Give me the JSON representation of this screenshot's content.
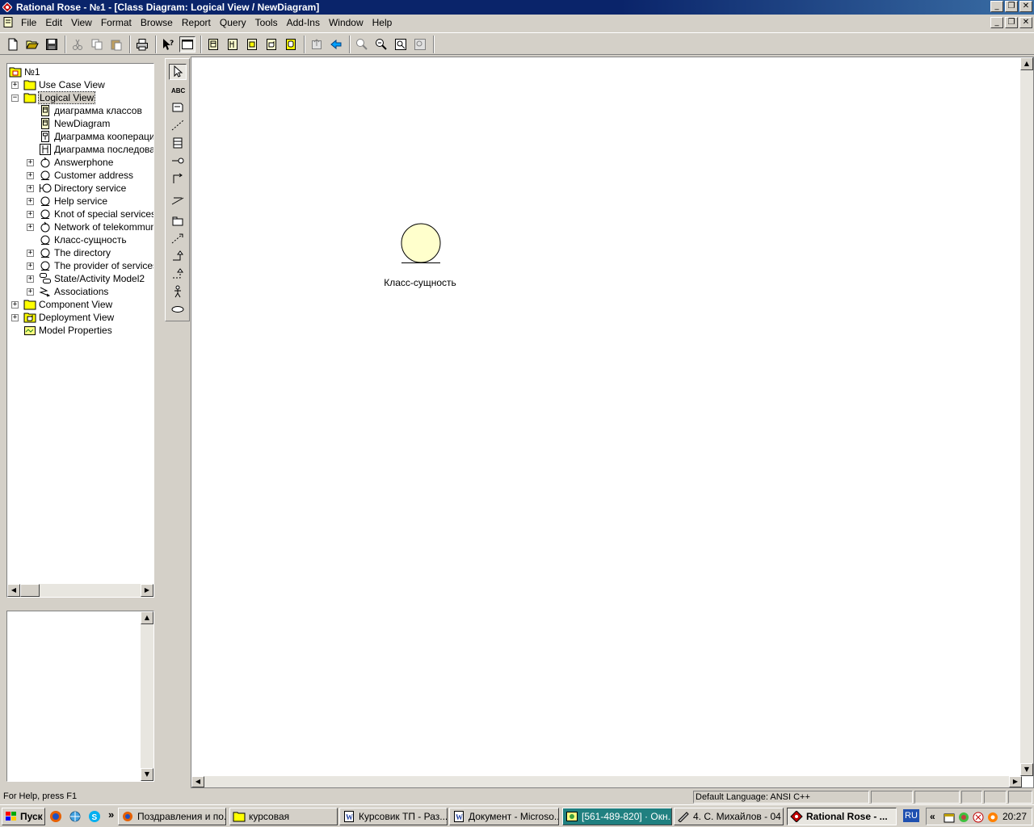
{
  "window": {
    "title": "Rational Rose - №1 - [Class Diagram: Logical View / NewDiagram]"
  },
  "menu": [
    "File",
    "Edit",
    "View",
    "Format",
    "Browse",
    "Report",
    "Query",
    "Tools",
    "Add-Ins",
    "Window",
    "Help"
  ],
  "toolbar_icons": [
    "new-icon",
    "open-icon",
    "save-icon",
    "cut-icon",
    "copy-icon",
    "paste-icon",
    "print-icon",
    "context-help-icon",
    "view-documentation-icon",
    "browse-class-diagram-icon",
    "browse-interaction-diagram-icon",
    "browse-component-diagram-icon",
    "browse-deployment-diagram-icon",
    "browse-parent-icon",
    "browse-previous-icon",
    "zoom-in-icon",
    "zoom-out-icon",
    "fit-in-window-icon",
    "undo-fit-icon"
  ],
  "tree": {
    "root": "№1",
    "items": [
      {
        "label": "Use Case View",
        "level": 0,
        "icon": "folder-icon",
        "expander": "+"
      },
      {
        "label": "Logical View",
        "level": 0,
        "icon": "folder-open-icon",
        "expander": "-",
        "selected": true
      },
      {
        "label": "диаграмма классов",
        "level": 1,
        "icon": "class-diagram-icon",
        "expander": ""
      },
      {
        "label": "NewDiagram",
        "level": 1,
        "icon": "class-diagram-icon",
        "expander": ""
      },
      {
        "label": "Диаграмма коопераци",
        "level": 1,
        "icon": "collaboration-diagram-icon",
        "expander": ""
      },
      {
        "label": "Диаграмма последоват",
        "level": 1,
        "icon": "sequence-diagram-icon",
        "expander": ""
      },
      {
        "label": "Answerphone",
        "level": 1,
        "icon": "control-class-icon",
        "expander": "+"
      },
      {
        "label": "Customer address",
        "level": 1,
        "icon": "entity-class-icon",
        "expander": "+"
      },
      {
        "label": "Directory service",
        "level": 1,
        "icon": "boundary-class-icon",
        "expander": "+"
      },
      {
        "label": "Help service",
        "level": 1,
        "icon": "entity-class-icon",
        "expander": "+"
      },
      {
        "label": "Knot of special services",
        "level": 1,
        "icon": "entity-class-icon",
        "expander": "+"
      },
      {
        "label": "Network of telekommunic",
        "level": 1,
        "icon": "control-class-icon",
        "expander": "+"
      },
      {
        "label": "Класс-сущность",
        "level": 1,
        "icon": "entity-class-icon",
        "expander": ""
      },
      {
        "label": "The directory",
        "level": 1,
        "icon": "entity-class-icon",
        "expander": "+"
      },
      {
        "label": "The provider of services c",
        "level": 1,
        "icon": "entity-class-icon",
        "expander": "+"
      },
      {
        "label": "State/Activity Model2",
        "level": 1,
        "icon": "state-activity-model-icon",
        "expander": "+"
      },
      {
        "label": "Associations",
        "level": 1,
        "icon": "associations-icon",
        "expander": "+"
      },
      {
        "label": "Component View",
        "level": 0,
        "icon": "folder-icon",
        "expander": "+"
      },
      {
        "label": "Deployment View",
        "level": 0,
        "icon": "deployment-view-icon",
        "expander": "+"
      },
      {
        "label": "Model Properties",
        "level": 0,
        "icon": "model-properties-icon",
        "expander": ""
      }
    ]
  },
  "diagram_tools": [
    "selection-tool-icon",
    "text-box-tool-icon",
    "note-tool-icon",
    "anchor-note-tool-icon",
    "class-tool-icon",
    "interface-tool-icon",
    "unidirectional-association-tool-icon",
    "association-class-tool-icon",
    "package-tool-icon",
    "dependency-tool-icon",
    "generalization-tool-icon",
    "realize-tool-icon",
    "actor-tool-icon",
    "use-case-tool-icon"
  ],
  "canvas": {
    "entity": {
      "name": "Класс-сущность",
      "fill": "#ffffcc"
    }
  },
  "status": {
    "help": "For Help, press F1",
    "language": "Default Language: ANSI C++"
  },
  "taskbar": {
    "start": "Пуск",
    "more": "»",
    "tasks": [
      {
        "label": "Поздравления и по...",
        "icon": "firefox-icon"
      },
      {
        "label": "курсовая",
        "icon": "folder-icon"
      },
      {
        "label": "Курсовик ТП - Раз...",
        "icon": "word-icon"
      },
      {
        "label": "Документ - Microso...",
        "icon": "word-icon"
      },
      {
        "label": "[561-489-820] · Окн...",
        "icon": "icq-icon"
      },
      {
        "label": "4. С. Михайлов - 04 ...",
        "icon": "player-icon"
      },
      {
        "label": "Rational Rose - ...",
        "icon": "rose-icon",
        "active": true
      }
    ],
    "lang": "RU",
    "tray_arrow": "«",
    "clock": "20:27"
  },
  "colors": {
    "titlebar": "#0a246a",
    "selection": "#d4d0c8",
    "entity_fill": "#ffffcc"
  }
}
